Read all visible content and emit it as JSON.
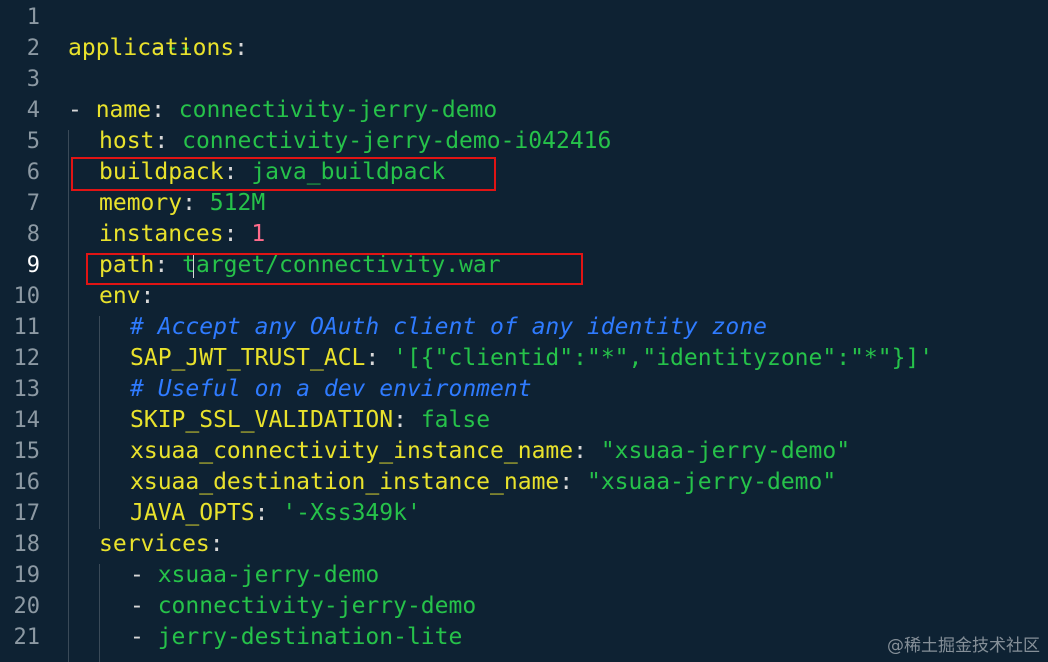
{
  "editor": {
    "active_line": 9,
    "lines": [
      {
        "n": "1"
      },
      {
        "n": "2"
      },
      {
        "n": "3"
      },
      {
        "n": "4"
      },
      {
        "n": "5"
      },
      {
        "n": "6"
      },
      {
        "n": "7"
      },
      {
        "n": "8"
      },
      {
        "n": "9"
      },
      {
        "n": "10"
      },
      {
        "n": "11"
      },
      {
        "n": "12"
      },
      {
        "n": "13"
      },
      {
        "n": "14"
      },
      {
        "n": "15"
      },
      {
        "n": "16"
      },
      {
        "n": "17"
      },
      {
        "n": "18"
      },
      {
        "n": "19"
      },
      {
        "n": "20"
      },
      {
        "n": "21"
      }
    ],
    "code": {
      "l1": {
        "marker": "---"
      },
      "l2": {
        "key": "applications",
        "colon": ":"
      },
      "l4": {
        "dash": "- ",
        "key": "name",
        "colon": ": ",
        "value": "connectivity-jerry-demo"
      },
      "l5": {
        "key": "host",
        "colon": ": ",
        "value": "connectivity-jerry-demo-i042416"
      },
      "l6": {
        "key": "buildpack",
        "colon": ": ",
        "value": "java_buildpack"
      },
      "l7": {
        "key": "memory",
        "colon": ": ",
        "value": "512M"
      },
      "l8": {
        "key": "instances",
        "colon": ": ",
        "value": "1"
      },
      "l9": {
        "key": "path",
        "colon": ": ",
        "value": "target/connectivity.war"
      },
      "l10": {
        "key": "env",
        "colon": ":"
      },
      "l11": {
        "comment": "# Accept any OAuth client of any identity zone"
      },
      "l12": {
        "key": "SAP_JWT_TRUST_ACL",
        "colon": ": ",
        "value": "'[{\"clientid\":\"*\",\"identityzone\":\"*\"}]'"
      },
      "l13": {
        "comment": "# Useful on a dev environment"
      },
      "l14": {
        "key": "SKIP_SSL_VALIDATION",
        "colon": ": ",
        "value": "false"
      },
      "l15": {
        "key": "xsuaa_connectivity_instance_name",
        "colon": ": ",
        "value": "\"xsuaa-jerry-demo\""
      },
      "l16": {
        "key": "xsuaa_destination_instance_name",
        "colon": ": ",
        "value": "\"xsuaa-jerry-demo\""
      },
      "l17": {
        "key": "JAVA_OPTS",
        "colon": ": ",
        "value": "'-Xss349k'"
      },
      "l18": {
        "key": "services",
        "colon": ":"
      },
      "l19": {
        "dash": "- ",
        "value": "xsuaa-jerry-demo"
      },
      "l20": {
        "dash": "- ",
        "value": "connectivity-jerry-demo"
      },
      "l21": {
        "dash": "- ",
        "value": "jerry-destination-lite"
      }
    },
    "highlights": [
      "buildpack-line",
      "path-line"
    ]
  },
  "watermark": "@稀土掘金技术社区",
  "colors": {
    "background": "#0e2233",
    "key": "#e9e22c",
    "string": "#26c24a",
    "number": "#ff6b8b",
    "comment": "#2f7bff",
    "highlight_border": "#e11414"
  }
}
